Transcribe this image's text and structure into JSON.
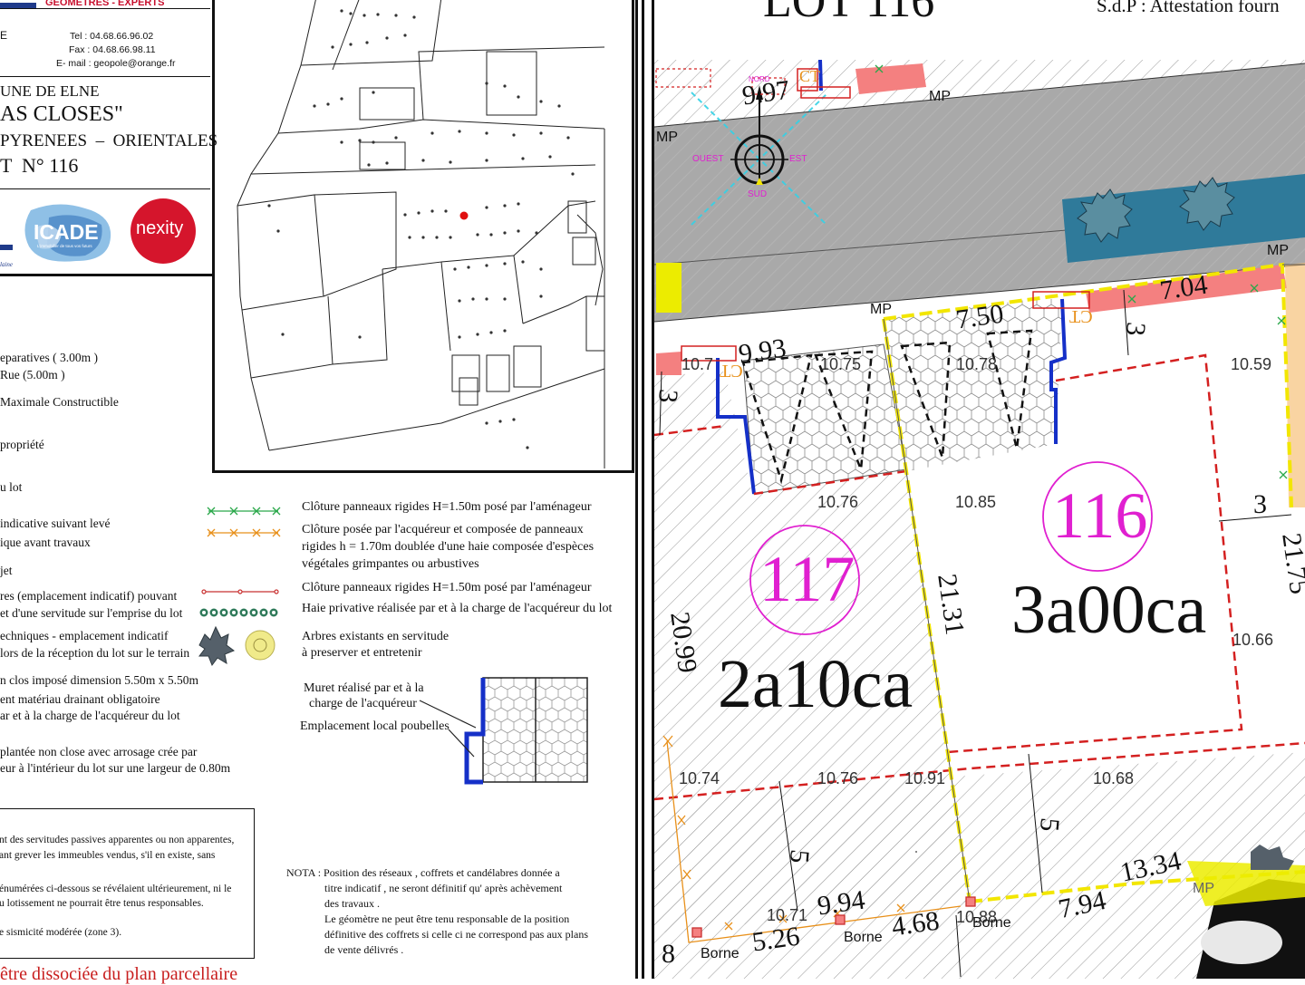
{
  "header": {
    "company_banner": "GEOMETRES - EXPERTS",
    "contact": {
      "tel": "Tel : 04.68.66.96.02",
      "fax": "Fax : 04.68.66.98.11",
      "email": "E- mail : geopole@orange.fr"
    },
    "project": {
      "commune": "UNE DE ELNE",
      "site": "AS CLOSES\"",
      "department": "PYRENEES  –  ORIENTALES",
      "lot": "T  N° 116"
    },
    "logos": {
      "icade": "ICADE",
      "icade_tagline": "L'immobilier de tous vos futurs",
      "nexity": "nexity",
      "partial_left": "laine"
    }
  },
  "legend_left": [
    "eparatives ( 3.00m )",
    "Rue (5.00m )",
    "Maximale Constructible",
    "propriété",
    "u lot",
    "indicative suivant levé",
    "ique avant travaux",
    "jet",
    "res (emplacement indicatif) pouvant",
    "et d'une servitude sur l'emprise du lot",
    "echniques - emplacement indicatif",
    "lors de la réception du lot sur le terrain",
    "n clos imposé dimension 5.50m  x 5.50m",
    "ent matériau drainant obligatoire",
    "ar et à la charge de l'acquéreur du lot",
    "plantée non close avec arrosage crée par",
    "eur à l'intérieur du lot sur une largeur de 0.80m"
  ],
  "legend_right": [
    "Clôture panneaux rigides H=1.50m posé par l'aménageur",
    "Clôture posée par l'acquéreur et composée de panneaux",
    "rigides h = 1.70m doublée d'une haie composée d'espèces",
    "végétales grimpantes ou arbustives",
    "Clôture panneaux rigides H=1.50m posé par l'aménageur",
    "Haie privative réalisée par et à la charge de l'acquéreur du lot",
    "Arbres existants en servitude",
    "à preserver et entretenir",
    "Muret réalisé par et à la",
    "charge de l'acquéreur",
    "Emplacement local poubelles"
  ],
  "notes_box": [
    "nt des servitudes passives apparentes ou non apparentes,",
    "ant grever les immeubles vendus, s'il en existe, sans",
    "énumérées ci-dessous se révélaient ultérieurement, ni le",
    "u lotissement ne pourrait être tenus responsables.",
    "e sismicité modérée (zone 3)."
  ],
  "nota": [
    "NOTA : Position des réseaux , coffrets et candélabres donnée a",
    "titre indicatif , ne seront définitif qu' après achèvement",
    "des travaux .",
    "Le géomètre ne peut être tenu responsable de la position",
    "définitive des coffrets si celle ci ne correspond pas aux plans",
    "de vente délivrés ."
  ],
  "bottom_left_red": "être dissociée du plan parcellaire",
  "plan": {
    "title_partial": "LOT 116",
    "sdp_label": "S.d.P : Attestation fourn",
    "compass": {
      "north": "NORD",
      "south": "SUD",
      "east": "EST",
      "west": "OUEST"
    },
    "mp": "MP",
    "lot_116": {
      "number": "116",
      "area": "3a00ca"
    },
    "lot_117": {
      "number": "117",
      "area": "2a10ca"
    },
    "borne": "Borne",
    "ct": "CT",
    "levels": [
      "10.7",
      "10.75",
      "10.78",
      "10.59",
      "10.76",
      "10.85",
      "10.66",
      "10.74",
      "10.76",
      "10.91",
      "10.68",
      "10.71",
      "10.88"
    ],
    "dims": [
      "9.97",
      "9.93",
      "7.50",
      "7.04",
      "3",
      "3",
      "21.31",
      "20.99",
      "21.75",
      "3",
      "5",
      "5",
      "13.34",
      "7.94",
      "9.94",
      "4.68",
      "5.26",
      "8"
    ]
  },
  "colors": {
    "boundary_yellow": "#f2e600",
    "fence_red": "#d42020",
    "lot_magenta": "#e020d0",
    "road_grey": "#a9a9a9",
    "wall_blue": "#1530c8",
    "pink_zone": "#f48080",
    "tree_blue": "#2f7a9a",
    "nexity_red": "#d5152c",
    "icade_blue": "#4a86c5"
  }
}
